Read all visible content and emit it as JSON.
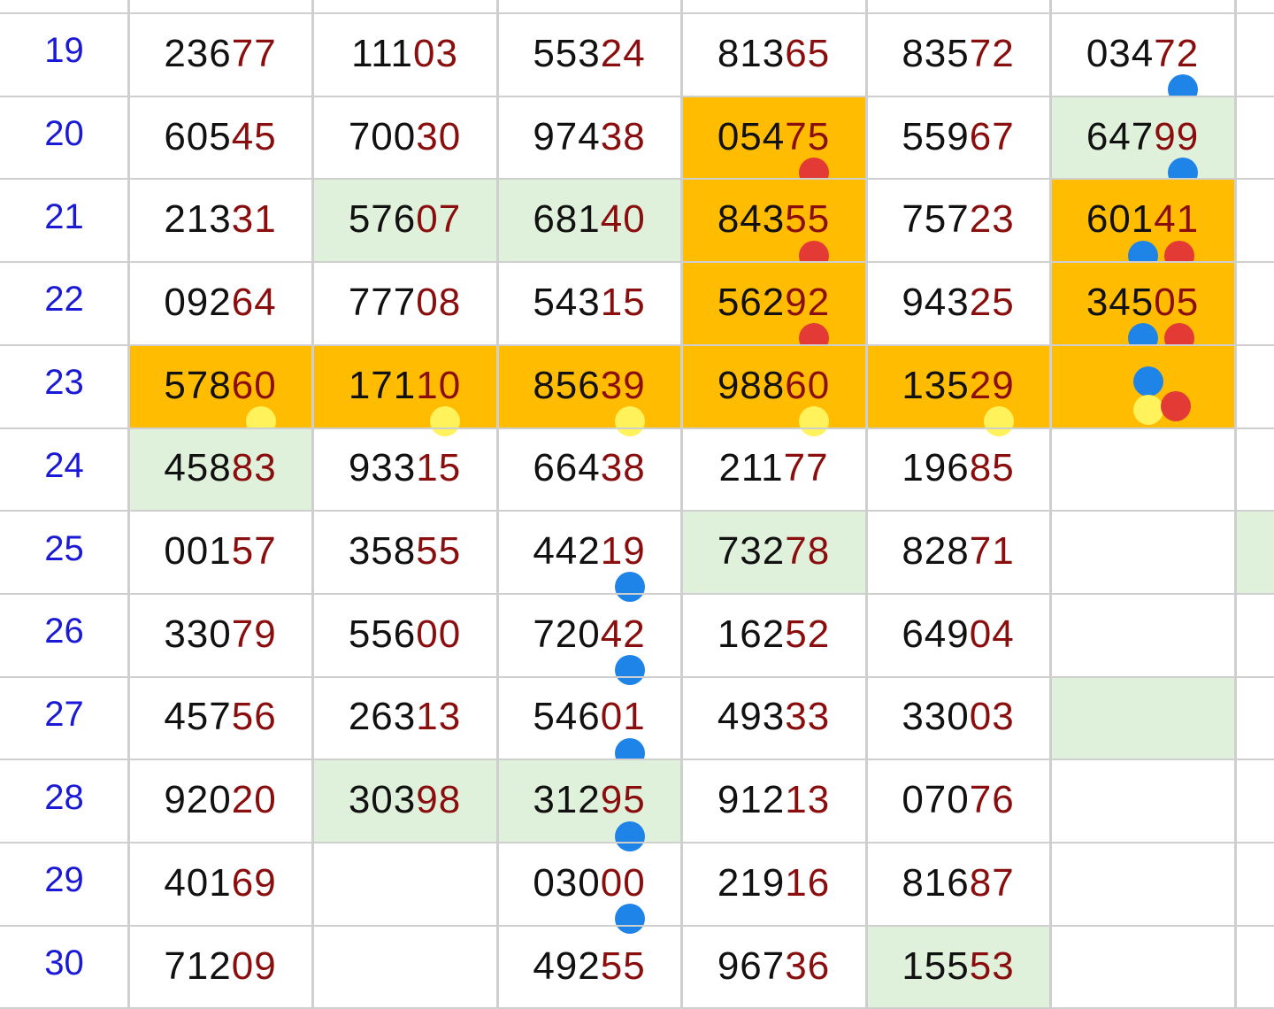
{
  "colors": {
    "green": "#e0f1db",
    "orange": "#ffbc00",
    "blue_dot": "#1f84e8",
    "red_dot": "#e33a36",
    "yellow_dot": "#fff25a",
    "row_number": "#1a1ad6",
    "digit_dark": "#111111",
    "digit_red": "#8b0e0e"
  },
  "rows": [
    {
      "label": "19",
      "cells": [
        {
          "head": "236",
          "tail": "77"
        },
        {
          "head": "111",
          "tail": "03"
        },
        {
          "head": "553",
          "tail": "24"
        },
        {
          "head": "813",
          "tail": "65"
        },
        {
          "head": "835",
          "tail": "72"
        },
        {
          "head": "034",
          "tail": "72",
          "dots": [
            "blue"
          ]
        },
        {
          "head": "",
          "tail": ""
        }
      ]
    },
    {
      "label": "20",
      "cells": [
        {
          "head": "605",
          "tail": "45"
        },
        {
          "head": "700",
          "tail": "30"
        },
        {
          "head": "974",
          "tail": "38"
        },
        {
          "head": "054",
          "tail": "75",
          "fill": "orange",
          "dots": [
            "red"
          ]
        },
        {
          "head": "559",
          "tail": "67"
        },
        {
          "head": "647",
          "tail": "99",
          "fill": "green",
          "dots": [
            "blue"
          ]
        },
        {
          "head": "",
          "tail": ""
        }
      ]
    },
    {
      "label": "21",
      "cells": [
        {
          "head": "213",
          "tail": "31"
        },
        {
          "head": "576",
          "tail": "07",
          "fill": "green"
        },
        {
          "head": "681",
          "tail": "40",
          "fill": "green"
        },
        {
          "head": "843",
          "tail": "55",
          "fill": "orange",
          "dots": [
            "red"
          ]
        },
        {
          "head": "757",
          "tail": "23"
        },
        {
          "head": "601",
          "tail": "41",
          "fill": "orange",
          "dots": [
            "blue",
            "red"
          ]
        },
        {
          "head": "",
          "tail": ""
        }
      ]
    },
    {
      "label": "22",
      "cells": [
        {
          "head": "092",
          "tail": "64"
        },
        {
          "head": "777",
          "tail": "08"
        },
        {
          "head": "543",
          "tail": "15"
        },
        {
          "head": "562",
          "tail": "92",
          "fill": "orange",
          "dots": [
            "red"
          ]
        },
        {
          "head": "943",
          "tail": "25"
        },
        {
          "head": "345",
          "tail": "05",
          "fill": "orange",
          "dots": [
            "blue",
            "red"
          ]
        },
        {
          "head": "",
          "tail": ""
        }
      ]
    },
    {
      "label": "23",
      "cells": [
        {
          "head": "578",
          "tail": "60",
          "fill": "orange",
          "dots": [
            "yellow"
          ]
        },
        {
          "head": "171",
          "tail": "10",
          "fill": "orange",
          "dots": [
            "yellow"
          ]
        },
        {
          "head": "856",
          "tail": "39",
          "fill": "orange",
          "dots": [
            "yellow"
          ]
        },
        {
          "head": "988",
          "tail": "60",
          "fill": "orange",
          "dots": [
            "yellow"
          ]
        },
        {
          "head": "135",
          "tail": "29",
          "fill": "orange",
          "dots": [
            "yellow"
          ]
        },
        {
          "head": "",
          "tail": "",
          "fill": "orange",
          "dots": [
            "blue",
            "yellow",
            "red"
          ]
        },
        {
          "head": "",
          "tail": ""
        }
      ]
    },
    {
      "label": "24",
      "cells": [
        {
          "head": "458",
          "tail": "83",
          "fill": "green"
        },
        {
          "head": "933",
          "tail": "15"
        },
        {
          "head": "664",
          "tail": "38"
        },
        {
          "head": "211",
          "tail": "77"
        },
        {
          "head": "196",
          "tail": "85"
        },
        {
          "head": "",
          "tail": ""
        },
        {
          "head": "",
          "tail": ""
        }
      ]
    },
    {
      "label": "25",
      "cells": [
        {
          "head": "001",
          "tail": "57"
        },
        {
          "head": "358",
          "tail": "55"
        },
        {
          "head": "442",
          "tail": "19",
          "dots": [
            "blue"
          ]
        },
        {
          "head": "732",
          "tail": "78",
          "fill": "green"
        },
        {
          "head": "828",
          "tail": "71"
        },
        {
          "head": "",
          "tail": ""
        },
        {
          "head": "",
          "tail": "",
          "fill": "green"
        }
      ]
    },
    {
      "label": "26",
      "cells": [
        {
          "head": "330",
          "tail": "79"
        },
        {
          "head": "556",
          "tail": "00"
        },
        {
          "head": "720",
          "tail": "42",
          "dots": [
            "blue"
          ]
        },
        {
          "head": "162",
          "tail": "52"
        },
        {
          "head": "649",
          "tail": "04"
        },
        {
          "head": "",
          "tail": ""
        },
        {
          "head": "",
          "tail": ""
        }
      ]
    },
    {
      "label": "27",
      "cells": [
        {
          "head": "457",
          "tail": "56"
        },
        {
          "head": "263",
          "tail": "13"
        },
        {
          "head": "546",
          "tail": "01",
          "dots": [
            "blue"
          ]
        },
        {
          "head": "493",
          "tail": "33"
        },
        {
          "head": "330",
          "tail": "03"
        },
        {
          "head": "",
          "tail": "",
          "fill": "green"
        },
        {
          "head": "",
          "tail": ""
        }
      ]
    },
    {
      "label": "28",
      "cells": [
        {
          "head": "920",
          "tail": "20"
        },
        {
          "head": "303",
          "tail": "98",
          "fill": "green"
        },
        {
          "head": "312",
          "tail": "95",
          "fill": "green",
          "dots": [
            "blue"
          ]
        },
        {
          "head": "912",
          "tail": "13"
        },
        {
          "head": "070",
          "tail": "76"
        },
        {
          "head": "",
          "tail": ""
        },
        {
          "head": "",
          "tail": ""
        }
      ]
    },
    {
      "label": "29",
      "cells": [
        {
          "head": "401",
          "tail": "69"
        },
        {
          "head": "",
          "tail": ""
        },
        {
          "head": "030",
          "tail": "00",
          "dots": [
            "blue"
          ]
        },
        {
          "head": "219",
          "tail": "16"
        },
        {
          "head": "816",
          "tail": "87"
        },
        {
          "head": "",
          "tail": ""
        },
        {
          "head": "",
          "tail": ""
        }
      ]
    },
    {
      "label": "30",
      "cells": [
        {
          "head": "712",
          "tail": "09"
        },
        {
          "head": "",
          "tail": ""
        },
        {
          "head": "492",
          "tail": "55"
        },
        {
          "head": "967",
          "tail": "36"
        },
        {
          "head": "155",
          "tail": "53",
          "fill": "green"
        },
        {
          "head": "",
          "tail": ""
        },
        {
          "head": "",
          "tail": ""
        }
      ]
    }
  ]
}
